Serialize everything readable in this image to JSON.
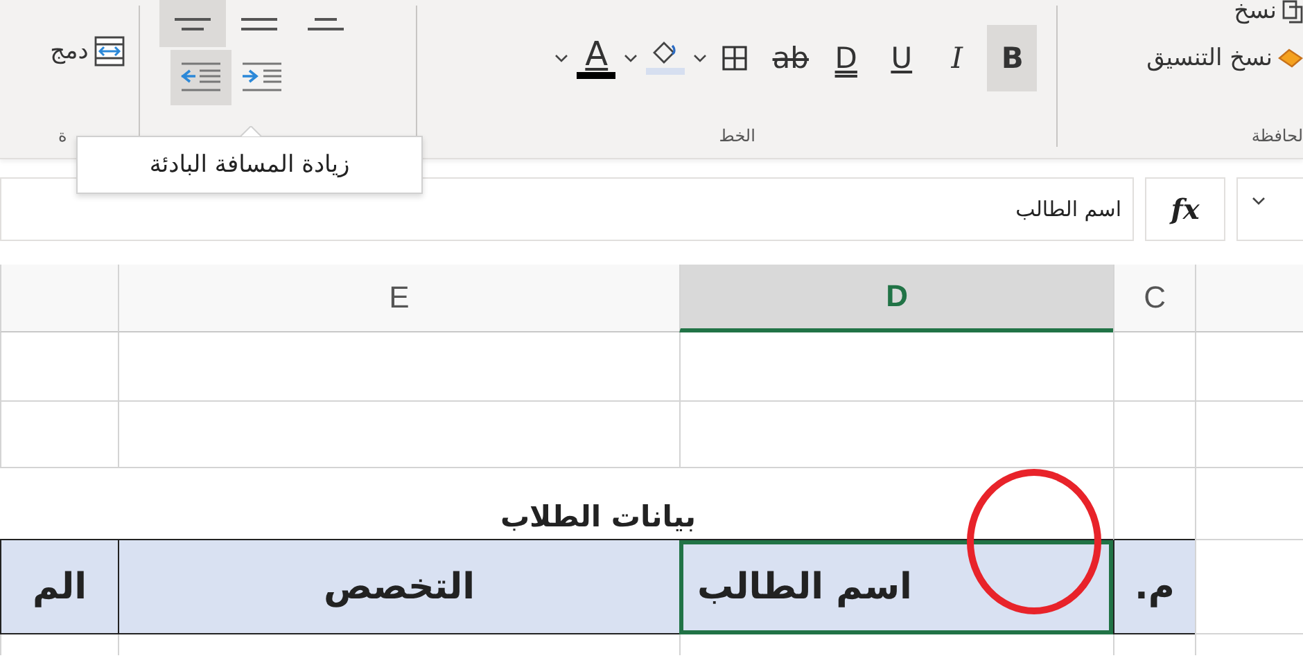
{
  "ribbon": {
    "merge_group": {
      "label": "ة",
      "button": {
        "label": "دمج"
      }
    },
    "alignment_group": {
      "align_buttons": [
        {
          "kind": "bottom",
          "selected": false
        },
        {
          "kind": "middle",
          "selected": false
        },
        {
          "kind": "top",
          "selected": true
        }
      ],
      "indent_buttons": [
        {
          "kind": "decrease",
          "hovered": false
        },
        {
          "kind": "increase",
          "hovered": true
        }
      ]
    },
    "font_group": {
      "label": "الخط",
      "buttons": [
        {
          "kind": "bold",
          "label": "B",
          "selected": true
        },
        {
          "kind": "italic",
          "label": "I",
          "selected": false
        },
        {
          "kind": "underline",
          "label": "U",
          "selected": false
        },
        {
          "kind": "double_underline",
          "label": "D",
          "selected": false
        },
        {
          "kind": "strikethrough",
          "label": "ab",
          "selected": false
        },
        {
          "kind": "borders"
        },
        {
          "kind": "fill_color"
        },
        {
          "kind": "font_color",
          "label": "A"
        }
      ]
    },
    "clipboard_group": {
      "label": "لحافظة",
      "copy": {
        "label": "نسخ"
      },
      "format_painter": {
        "label": "نسخ التنسيق"
      }
    }
  },
  "tooltip": {
    "text": "زيادة المسافة البادئة"
  },
  "formula_bar": {
    "value": "اسم الطالب",
    "fx": "fx"
  },
  "sheet": {
    "columns": [
      {
        "label": "C",
        "selected": false
      },
      {
        "label": "D",
        "selected": true
      },
      {
        "label": "E",
        "selected": false
      }
    ],
    "title": "بيانات الطلاب",
    "header_row": [
      {
        "text": "م.",
        "selected": false
      },
      {
        "text": "اسم الطالب",
        "selected": true
      },
      {
        "text": "التخصص",
        "selected": false
      },
      {
        "text": "الم",
        "selected": false
      }
    ]
  }
}
